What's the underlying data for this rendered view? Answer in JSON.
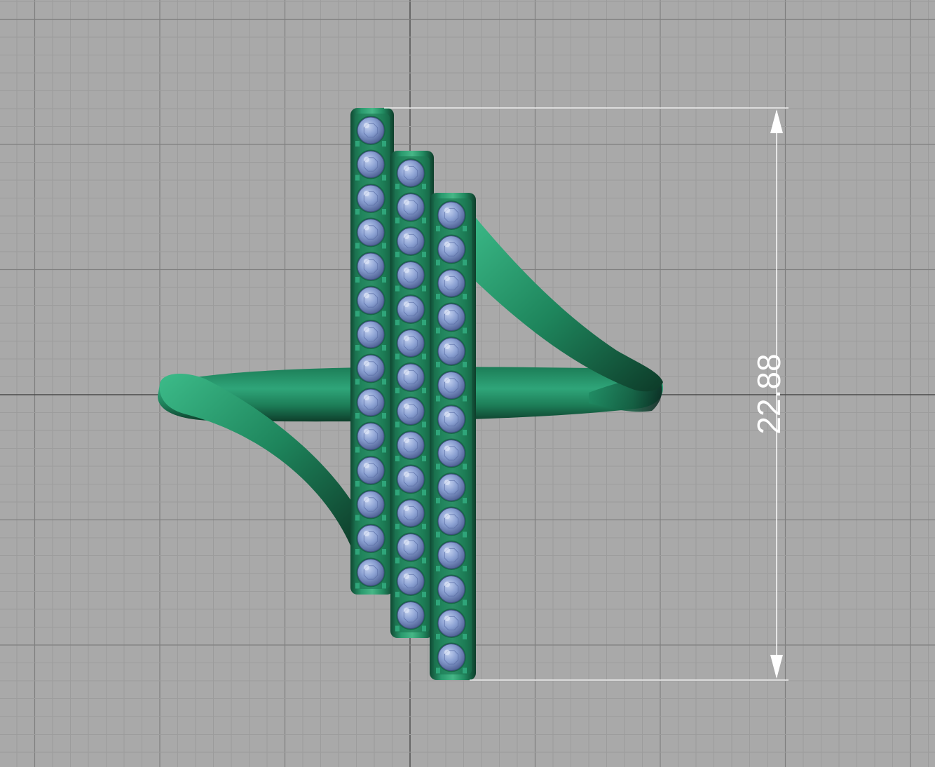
{
  "viewport": {
    "background_color": "#a9a9a9",
    "grid_minor_color": "#9c9c9c",
    "grid_major_color": "#7f7f7f",
    "axis_color": "#4a4a4a"
  },
  "model": {
    "metal_color": "#1f8a62",
    "metal_dark_color": "#0f3f2c",
    "metal_light_color": "#4fc79a",
    "stone_color": "#7f96c9",
    "stone_light_color": "#b4c4e8",
    "stone_dark_color": "#4f6194",
    "bars": [
      {
        "stone_count": 14
      },
      {
        "stone_count": 14
      },
      {
        "stone_count": 14
      }
    ]
  },
  "dimension": {
    "value": "22.88",
    "color": "#ffffff"
  }
}
